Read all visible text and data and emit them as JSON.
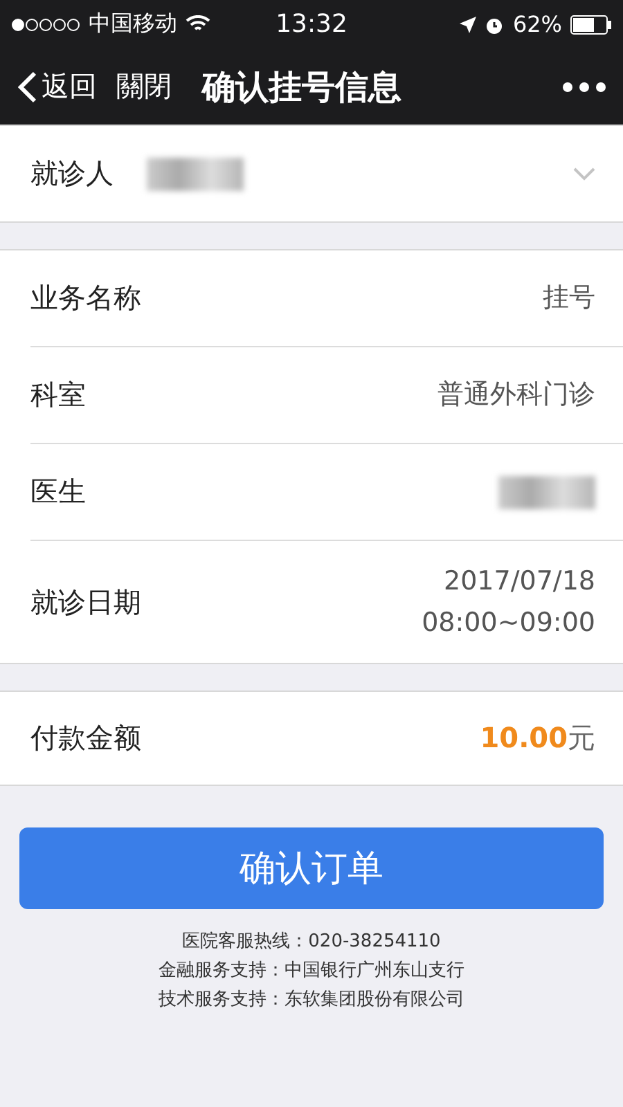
{
  "status_bar": {
    "carrier": "中国移动",
    "time": "13:32",
    "battery": "62%"
  },
  "nav": {
    "back": "返回",
    "close": "關閉",
    "title": "确认挂号信息"
  },
  "patient": {
    "label": "就诊人",
    "kind": "redacted"
  },
  "details": [
    {
      "label": "业务名称",
      "kind": "text",
      "value": [
        "挂号"
      ]
    },
    {
      "label": "科室",
      "kind": "text",
      "value": [
        "普通外科门诊"
      ]
    },
    {
      "label": "医生",
      "kind": "redacted"
    },
    {
      "label": "就诊日期",
      "kind": "text",
      "value": [
        "2017/07/18",
        "08:00~09:00"
      ]
    }
  ],
  "payment": {
    "label": "付款金额",
    "amount": "10.00",
    "unit": "元"
  },
  "confirm_button": "确认订单",
  "footer": [
    "医院客服热线：020-38254110",
    "金融服务支持：中国银行广州东山支行",
    "技术服务支持：东软集团股份有限公司"
  ]
}
